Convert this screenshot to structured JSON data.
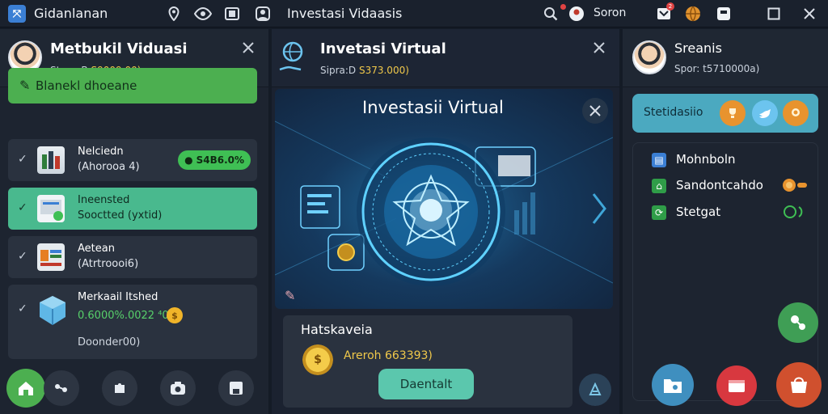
{
  "topbar": {
    "app_name": "Gidanlanan",
    "title": "Investasi Vidaasis",
    "user": "Soron",
    "notif_count": "2"
  },
  "left_panel": {
    "title": "Metbukil Viduasi",
    "sub_prefix": "Stypo:B",
    "sub_amount": "S9009.00)",
    "banner": "Blanekl dhoeane",
    "items": [
      {
        "title": "Nelciedn",
        "sub": "(Ahorooa 4)",
        "pill": "S4B6.0%"
      },
      {
        "title": "Ineensted",
        "sub": "Sooctted (yxtid)"
      },
      {
        "title": "Aetean",
        "sub": "(Atrtroooi6)"
      },
      {
        "title": "Merkaail Itshed",
        "sub": "0.6000%.0022 ⁴0",
        "extra": "Doonder00)"
      }
    ]
  },
  "mid_panel": {
    "title": "Invetasi Virtual",
    "sub_prefix": "Sipra:D",
    "sub_amount": "S373.000)",
    "hero_title": "Investasii Virtual",
    "card_title": "Hatskaveia",
    "card_amount": "Areroh 663393)",
    "card_button": "Daentalt",
    "coin_symbol": "$"
  },
  "right_panel": {
    "title": "Sreanis",
    "sub": "Spor: t5710000a)",
    "banner": "Stetidasiio",
    "items": [
      {
        "label": "Mohnboln"
      },
      {
        "label": "Sandontcahdo"
      },
      {
        "label": "Stetgat"
      }
    ]
  },
  "colors": {
    "accent_green": "#4caf50",
    "accent_teal": "#5bc7ad",
    "gold": "#f0c84a",
    "background": "#141b26"
  }
}
